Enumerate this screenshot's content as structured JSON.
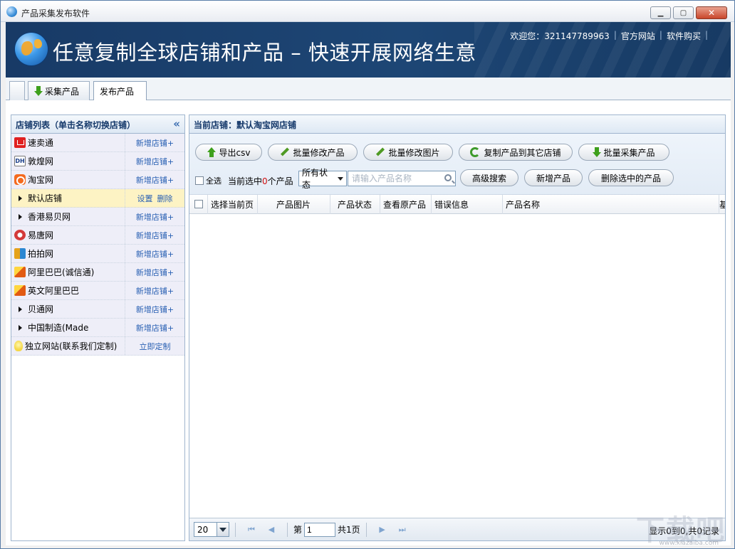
{
  "window": {
    "title": "产品采集发布软件",
    "controls": {
      "minimize": "▁",
      "maximize": "▢",
      "close": "✕"
    }
  },
  "banner": {
    "headline": "任意复制全球店铺和产品 – 快速开展网络生意",
    "welcome": "欢迎您：321147789963",
    "official_site": "官方网站",
    "buy": "软件购买"
  },
  "tabs": [
    {
      "label": ""
    },
    {
      "label": "采集产品",
      "icon": "arrow-down-icon"
    },
    {
      "label": "发布产品",
      "active": true
    }
  ],
  "left_panel": {
    "title": "店铺列表（单击名称切换店铺）",
    "collapse_glyph": "«",
    "shops": [
      {
        "name": "速卖通",
        "icon": "sumaitong-icon",
        "action": "新增店铺+"
      },
      {
        "name": "敦煌网",
        "icon": "dhgate-icon",
        "icon_text": "DH",
        "action": "新增店铺+"
      },
      {
        "name": "淘宝网",
        "icon": "taobao-icon",
        "action": "新增店铺+"
      },
      {
        "name": "默认店铺",
        "icon": "expand-icon",
        "active": true,
        "action_set": "设置",
        "action_delete": "删除"
      },
      {
        "name": "香港易贝网",
        "icon": "expand-icon",
        "action": "新增店铺+"
      },
      {
        "name": "易唐网",
        "icon": "yitang-icon",
        "action": "新增店铺+"
      },
      {
        "name": "拍拍网",
        "icon": "paipai-icon",
        "action": "新增店铺+"
      },
      {
        "name": "阿里巴巴(诚信通)",
        "icon": "alibaba-icon",
        "action": "新增店铺+"
      },
      {
        "name": "英文阿里巴巴",
        "icon": "alibaba-icon",
        "action": "新增店铺+"
      },
      {
        "name": "贝通网",
        "icon": "expand-icon",
        "action": "新增店铺+"
      },
      {
        "name": "中国制造(Made",
        "icon": "expand-icon",
        "action": "新增店铺+"
      },
      {
        "name": "独立网站(联系我们定制)",
        "icon": "bulb-icon",
        "action": "立即定制"
      }
    ]
  },
  "right_panel": {
    "title": "当前店铺：默认淘宝网店铺",
    "buttons": {
      "export_csv": "导出csv",
      "batch_edit_products": "批量修改产品",
      "batch_edit_images": "批量修改图片",
      "copy_to_other_shop": "复制产品到其它店铺",
      "batch_collect": "批量采集产品",
      "advanced_search": "高级搜索",
      "add_product": "新增产品",
      "delete_selected": "删除选中的产品"
    },
    "select_all": "全选",
    "selected_prefix": "当前选中",
    "selected_count": "0",
    "selected_suffix": "个产品",
    "status_select": "所有状态",
    "search_placeholder": "请输入产品名称",
    "columns": [
      "选择当前页",
      "产品图片",
      "产品状态",
      "查看原产品",
      "错误信息",
      "产品名称",
      "基"
    ]
  },
  "pager": {
    "page_size": "20",
    "first": "⏮",
    "prev": "◀",
    "page_prefix": "第",
    "page_value": "1",
    "page_suffix": "共1页",
    "next": "▶",
    "last": "⏭",
    "info": "显示0到0,共0记录"
  },
  "watermark": {
    "text": "下载吧",
    "small": "www.xiazaiba.com"
  }
}
